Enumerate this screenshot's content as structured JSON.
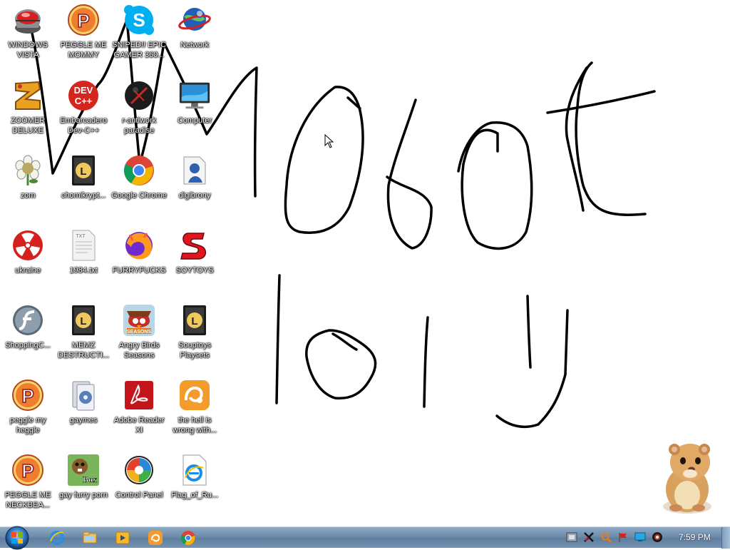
{
  "desktop": {
    "icons": [
      {
        "label": "WINDOWS VISTA",
        "icon": "vista-orb-icon"
      },
      {
        "label": "PEGGLE ME MOMMY",
        "icon": "peggle-icon"
      },
      {
        "label": "SNIPED!! EPIC GAMER 360...",
        "icon": "skype-icon"
      },
      {
        "label": "Network",
        "icon": "network-globe-icon"
      },
      {
        "label": "ZOOMER DELUXE",
        "icon": "zuma-icon"
      },
      {
        "label": "Embarcadero Dev-C++",
        "icon": "devcpp-icon"
      },
      {
        "label": "r-antiwork paradise",
        "icon": "dark-sphere-icon"
      },
      {
        "label": "Computer",
        "icon": "computer-monitor-icon"
      },
      {
        "label": "zom",
        "icon": "zombie-flower-icon"
      },
      {
        "label": "chomikrypt...",
        "icon": "shortcut-clock-icon"
      },
      {
        "label": "Google Chrome",
        "icon": "chrome-icon"
      },
      {
        "label": "digibrony",
        "icon": "digibrony-icon"
      },
      {
        "label": "ukraine",
        "icon": "radiation-icon"
      },
      {
        "label": "1984.txt",
        "icon": "text-file-icon"
      },
      {
        "label": "FURRYFUCKS",
        "icon": "firefox-icon"
      },
      {
        "label": "SOYTOYS",
        "icon": "red-s-icon"
      },
      {
        "label": "ShoppingC...",
        "icon": "flash-icon"
      },
      {
        "label": "MEMZ DESTRUCTI...",
        "icon": "shortcut-clock-icon"
      },
      {
        "label": "Angry Birds Seasons",
        "icon": "angry-birds-icon"
      },
      {
        "label": "Souptoys Playsets",
        "icon": "shortcut-clock-icon"
      },
      {
        "label": "peggle my heggle",
        "icon": "peggle-icon"
      },
      {
        "label": "gaymes",
        "icon": "games-folder-icon"
      },
      {
        "label": "Adobe Reader XI",
        "icon": "adobe-reader-icon"
      },
      {
        "label": "the hell is wrong with...",
        "icon": "uc-browser-icon"
      },
      {
        "label": "PEGGLE ME NECKBEA...",
        "icon": "peggle-icon"
      },
      {
        "label": "gay furry porn",
        "icon": "box-beaver-icon"
      },
      {
        "label": "Control Panel",
        "icon": "control-panel-icon"
      },
      {
        "label": "Flag_of_Ru...",
        "icon": "ie-html-file-icon"
      }
    ]
  },
  "taskbar": {
    "start": "start-orb-icon",
    "pinned": [
      "internet-explorer-icon",
      "explorer-folder-icon",
      "media-player-icon",
      "uc-browser-icon",
      "chrome-icon"
    ],
    "tray": [
      "tray-generic-icon",
      "tray-antivirus-icon",
      "tray-search-icon",
      "tray-flag-icon",
      "tray-display-icon",
      "tray-volume-icon"
    ],
    "clock": "7:59 PM"
  },
  "colors": {
    "taskbar": "#6e8cab",
    "ink": "#000000"
  }
}
